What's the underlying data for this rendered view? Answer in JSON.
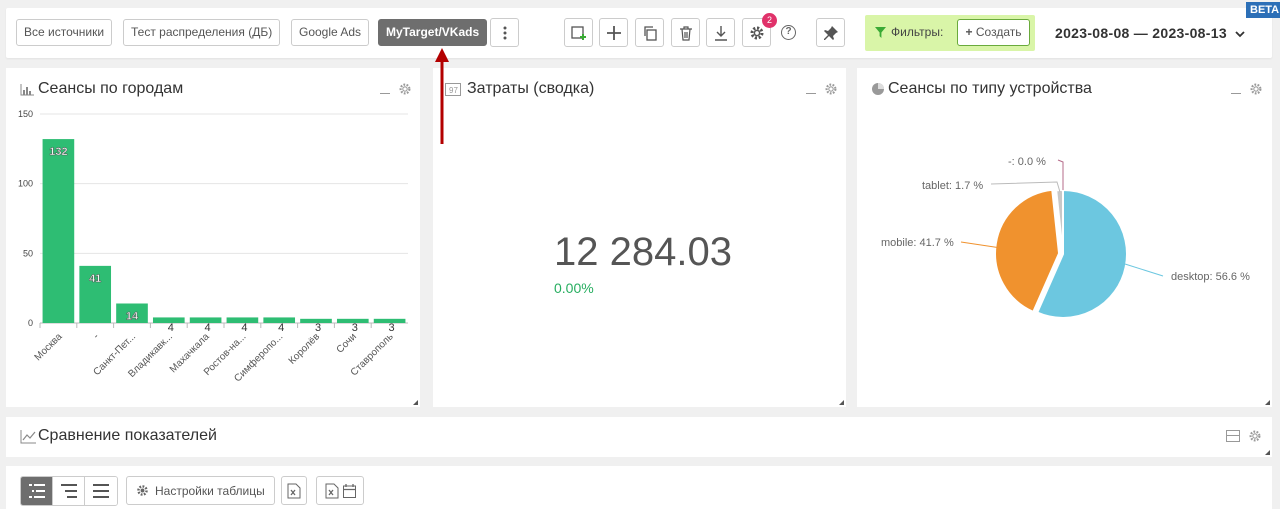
{
  "toolbar": {
    "sources": [
      "Все источники",
      "Тест распределения (ДБ)",
      "Google Ads",
      "MyTarget/VKads"
    ],
    "active_source_index": 3,
    "settings_badge": "2",
    "filters_label": "Фильтры:",
    "create_label": "Создать",
    "date_range": "2023-08-08 — 2023-08-13",
    "beta": "BETA"
  },
  "panels": {
    "city_sessions": {
      "title": "Сеансы по городам"
    },
    "costs": {
      "title": "Затраты (сводка)",
      "value": "12 284.03",
      "change": "0.00%"
    },
    "device_sessions": {
      "title": "Сеансы по типу устройства"
    },
    "comparison": {
      "title": "Сравнение показателей"
    }
  },
  "bottom": {
    "table_settings": "Настройки таблицы"
  },
  "colors": {
    "bar": "#2ebd73",
    "desktop": "#6cc7e0",
    "mobile": "#f0922e",
    "tablet": "#c8c8c8",
    "other": "#b56b8a",
    "arrow": "#b30000"
  },
  "chart_data": [
    {
      "type": "bar",
      "categories": [
        "Москва",
        "-",
        "Санкт-Пет...",
        "Владикавк...",
        "Махачкала",
        "Ростов-на...",
        "Симферопо...",
        "Королёв",
        "Сочи",
        "Ставрополь"
      ],
      "values": [
        132,
        41,
        14,
        4,
        4,
        4,
        4,
        3,
        3,
        3
      ],
      "yticks": [
        0,
        50,
        100,
        150
      ],
      "ylim": [
        0,
        150
      ]
    },
    {
      "type": "pie",
      "labels": [
        "desktop",
        "mobile",
        "tablet",
        "-"
      ],
      "values": [
        56.6,
        41.7,
        1.7,
        0.0
      ],
      "label_texts": [
        "desktop: 56.6 %",
        "mobile: 41.7 %",
        "tablet: 1.7 %",
        "-: 0.0 %"
      ]
    }
  ]
}
